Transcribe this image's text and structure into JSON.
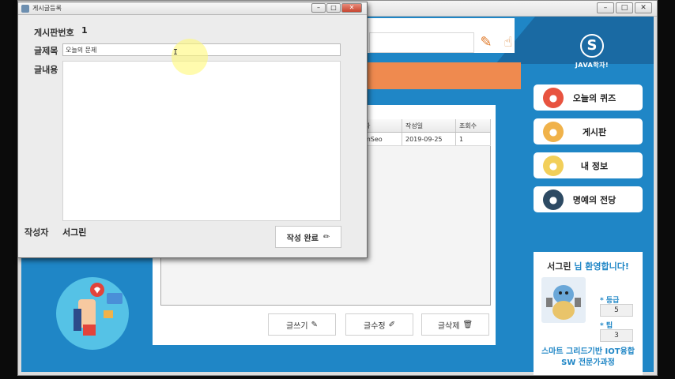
{
  "dialog": {
    "title": "게시글등록",
    "fields": {
      "board_no_label": "게시판번호",
      "board_no_value": "1",
      "title_label": "글제목",
      "title_value": "오늘의 문제",
      "content_label": "글내용",
      "author_label": "작성자",
      "author_value": "서그린"
    },
    "submit_label": "작성 완료"
  },
  "board": {
    "columns": [
      "자",
      "작성일",
      "조회수"
    ],
    "rows": [
      [
        "mSeo",
        "2019-09-25",
        "1"
      ]
    ],
    "buttons": {
      "write": "글쓰기",
      "edit": "글수정",
      "delete": "글삭제"
    }
  },
  "logo_text": "JAVA학자!",
  "sidebar": {
    "items": [
      {
        "label": "오늘의 퀴즈",
        "icon": "quiz-icon",
        "color": "#e8533f"
      },
      {
        "label": "게시판",
        "icon": "board-icon",
        "color": "#f0b24a"
      },
      {
        "label": "내 정보",
        "icon": "profile-icon",
        "color": "#f2cf5a"
      },
      {
        "label": "명예의 전당",
        "icon": "medal-icon",
        "color": "#2d4a63"
      }
    ]
  },
  "welcome": {
    "name": "서그린",
    "suffix": "님 환영합니다!",
    "grade_label": "등급",
    "grade_value": "5",
    "tip_label": "팁",
    "tip_value": "3",
    "course_line1": "스마트 그리드기반 IOT융합",
    "course_line2": "SW 전문가과정"
  },
  "colors": {
    "primary_blue": "#1f86c6",
    "accent_orange": "#ef8a4f"
  }
}
